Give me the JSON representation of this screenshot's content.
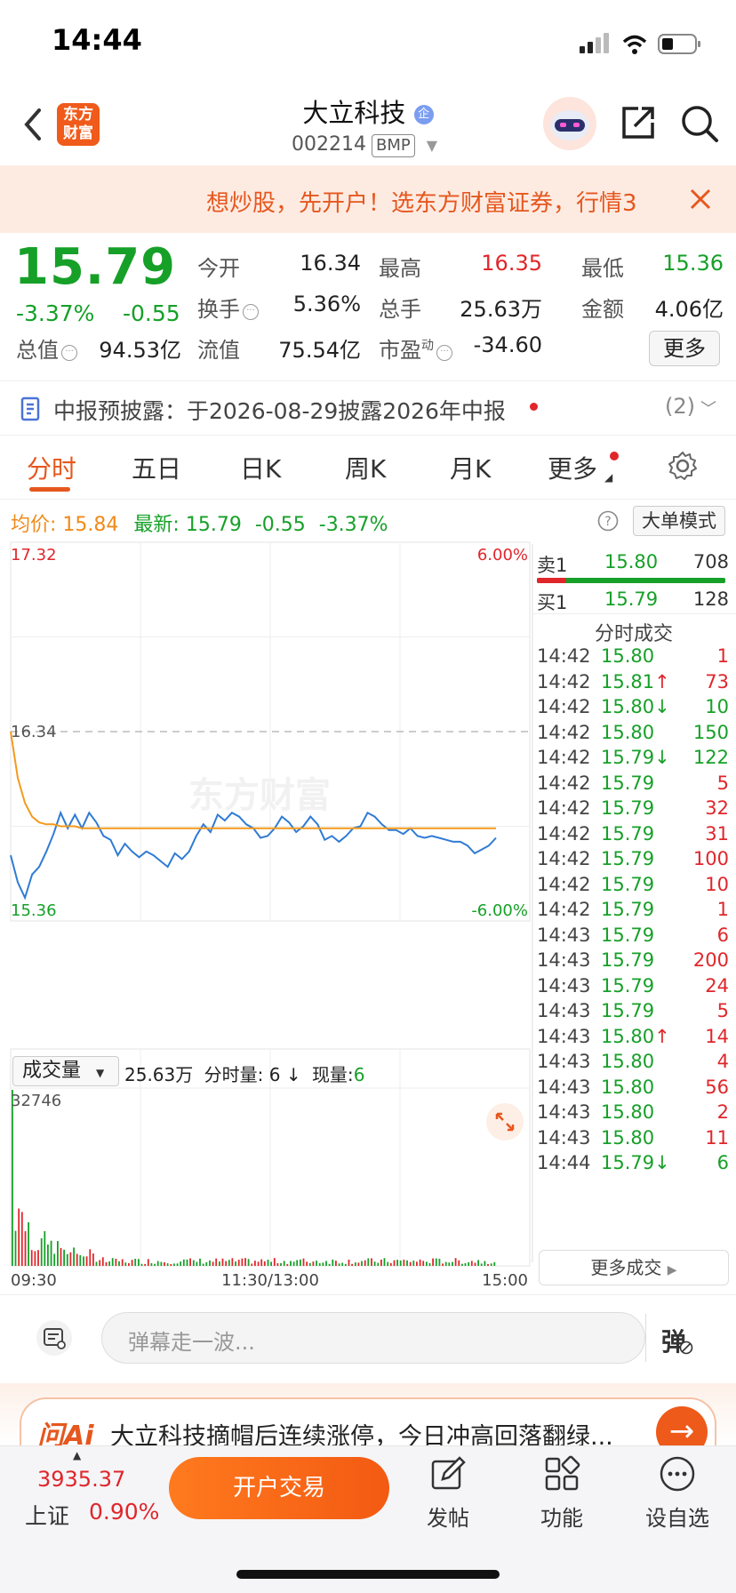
{
  "status_bar": {
    "time": "14:44"
  },
  "header": {
    "app_logo": "东方财富",
    "stock_name": "大立科技",
    "badge": "企",
    "stock_code": "002214",
    "market_tag": "BMP"
  },
  "banner": {
    "text": "想炒股，先开户！选东方财富证券，行情3"
  },
  "quote": {
    "price": "15.79",
    "change_pct": "-3.37%",
    "change": "-0.55",
    "fields": [
      {
        "label": "今开",
        "value": "16.34",
        "color": "#222222"
      },
      {
        "label": "最高",
        "value": "16.35",
        "color": "#e0262b"
      },
      {
        "label": "最低",
        "value": "15.36",
        "color": "#16a028"
      },
      {
        "label": "换手",
        "value": "5.36%",
        "color": "#222222"
      },
      {
        "label": "总手",
        "value": "25.63万",
        "color": "#222222"
      },
      {
        "label": "金额",
        "value": "4.06亿",
        "color": "#222222"
      },
      {
        "label": "总值",
        "value": "94.53亿",
        "color": "#222222"
      },
      {
        "label": "流值",
        "value": "75.54亿",
        "color": "#222222"
      },
      {
        "label": "市盈",
        "value": "-34.60",
        "color": "#222222"
      }
    ],
    "pe_sup": "动",
    "more_label": "更多"
  },
  "notice": {
    "text": "中报预披露：于2026-08-29披露2026年中报",
    "count": "(2)"
  },
  "tabs": [
    "分时",
    "五日",
    "日K",
    "周K",
    "月K",
    "更多"
  ],
  "info_line": {
    "avg_label": "均价:",
    "avg_value": "15.84",
    "latest_label": "最新:",
    "latest_value": "15.79",
    "latest_change": "-0.55",
    "latest_pct": "-3.37%",
    "big_order_label": "大单模式"
  },
  "chart_data": {
    "type": "line",
    "title": "",
    "watermark": "东方财富",
    "y_top_label": "17.32",
    "y_bottom_label": "15.36",
    "pct_top_label": "6.00%",
    "pct_bottom_label": "-6.00%",
    "prev_close_label": "16.34",
    "ylim": [
      15.36,
      17.32
    ],
    "prev_close": 16.34,
    "x_labels": [
      "09:30",
      "11:30/13:00",
      "15:00"
    ],
    "series": [
      {
        "name": "最新",
        "color": "#2f7bd4",
        "values": [
          15.7,
          15.56,
          15.48,
          15.6,
          15.64,
          15.72,
          15.81,
          15.92,
          15.84,
          15.91,
          15.84,
          15.92,
          15.87,
          15.8,
          15.78,
          15.7,
          15.76,
          15.72,
          15.69,
          15.72,
          15.7,
          15.67,
          15.64,
          15.71,
          15.68,
          15.72,
          15.8,
          15.86,
          15.82,
          15.91,
          15.88,
          15.92,
          15.9,
          15.86,
          15.84,
          15.79,
          15.8,
          15.84,
          15.9,
          15.87,
          15.82,
          15.85,
          15.9,
          15.86,
          15.78,
          15.8,
          15.77,
          15.8,
          15.84,
          15.85,
          15.92,
          15.9,
          15.86,
          15.83,
          15.83,
          15.81,
          15.84,
          15.8,
          15.79,
          15.8,
          15.79,
          15.78,
          15.77,
          15.77,
          15.75,
          15.71,
          15.73,
          15.75,
          15.79
        ]
      },
      {
        "name": "均价",
        "color": "#f39a1e",
        "values": [
          16.34,
          16.1,
          15.97,
          15.9,
          15.87,
          15.86,
          15.86,
          15.85,
          15.85,
          15.85,
          15.84,
          15.84,
          15.84,
          15.84,
          15.84,
          15.84,
          15.84,
          15.84,
          15.84,
          15.84,
          15.84,
          15.84,
          15.84,
          15.84,
          15.84,
          15.84,
          15.84,
          15.84,
          15.84,
          15.84,
          15.84,
          15.84,
          15.84,
          15.84,
          15.84,
          15.84,
          15.84,
          15.84,
          15.84,
          15.84,
          15.84,
          15.84,
          15.84,
          15.84,
          15.84,
          15.84,
          15.84,
          15.84,
          15.84,
          15.84,
          15.84,
          15.84,
          15.84,
          15.84,
          15.84,
          15.84,
          15.84,
          15.84,
          15.84,
          15.84,
          15.84,
          15.84,
          15.84,
          15.84,
          15.84,
          15.84,
          15.84,
          15.84,
          15.84
        ]
      }
    ],
    "volume": {
      "selector_label": "成交量",
      "total": "25.63万",
      "period_label": "分时量:",
      "period_value": "6 ↓",
      "current_label": "现量:",
      "current_value": "6",
      "max_label": "32746",
      "max": 32746
    }
  },
  "order_book": {
    "sell": {
      "label": "卖1",
      "price": "15.80",
      "vol": "708"
    },
    "buy": {
      "label": "买1",
      "price": "15.79",
      "vol": "128"
    }
  },
  "trades": {
    "title": "分时成交",
    "rows": [
      {
        "time": "14:42",
        "price": "15.80",
        "arrow": "",
        "vol": "1",
        "dir": "buy"
      },
      {
        "time": "14:42",
        "price": "15.81",
        "arrow": "↑",
        "vol": "73",
        "dir": "buy"
      },
      {
        "time": "14:42",
        "price": "15.80",
        "arrow": "↓",
        "vol": "10",
        "dir": "sell"
      },
      {
        "time": "14:42",
        "price": "15.80",
        "arrow": "",
        "vol": "150",
        "dir": "sell"
      },
      {
        "time": "14:42",
        "price": "15.79",
        "arrow": "↓",
        "vol": "122",
        "dir": "sell"
      },
      {
        "time": "14:42",
        "price": "15.79",
        "arrow": "",
        "vol": "5",
        "dir": "buy"
      },
      {
        "time": "14:42",
        "price": "15.79",
        "arrow": "",
        "vol": "32",
        "dir": "buy"
      },
      {
        "time": "14:42",
        "price": "15.79",
        "arrow": "",
        "vol": "31",
        "dir": "buy"
      },
      {
        "time": "14:42",
        "price": "15.79",
        "arrow": "",
        "vol": "100",
        "dir": "buy"
      },
      {
        "time": "14:42",
        "price": "15.79",
        "arrow": "",
        "vol": "10",
        "dir": "buy"
      },
      {
        "time": "14:42",
        "price": "15.79",
        "arrow": "",
        "vol": "1",
        "dir": "buy"
      },
      {
        "time": "14:43",
        "price": "15.79",
        "arrow": "",
        "vol": "6",
        "dir": "buy"
      },
      {
        "time": "14:43",
        "price": "15.79",
        "arrow": "",
        "vol": "200",
        "dir": "buy"
      },
      {
        "time": "14:43",
        "price": "15.79",
        "arrow": "",
        "vol": "24",
        "dir": "buy"
      },
      {
        "time": "14:43",
        "price": "15.79",
        "arrow": "",
        "vol": "5",
        "dir": "buy"
      },
      {
        "time": "14:43",
        "price": "15.80",
        "arrow": "↑",
        "vol": "14",
        "dir": "buy"
      },
      {
        "time": "14:43",
        "price": "15.80",
        "arrow": "",
        "vol": "4",
        "dir": "buy"
      },
      {
        "time": "14:43",
        "price": "15.80",
        "arrow": "",
        "vol": "56",
        "dir": "buy"
      },
      {
        "time": "14:43",
        "price": "15.80",
        "arrow": "",
        "vol": "2",
        "dir": "buy"
      },
      {
        "time": "14:43",
        "price": "15.80",
        "arrow": "",
        "vol": "11",
        "dir": "buy"
      },
      {
        "time": "14:44",
        "price": "15.79",
        "arrow": "↓",
        "vol": "6",
        "dir": "sell"
      }
    ],
    "more_label": "更多成交"
  },
  "comment_bar": {
    "placeholder": "弹幕走一波...",
    "danmu_label": "弹"
  },
  "ai_bar": {
    "logo": "问Ai",
    "text": "大立科技摘帽后连续涨停，今日冲高回落翻绿..."
  },
  "bottom_nav": {
    "index_value": "3935.37",
    "index_name": "上证",
    "index_pct": "0.90%",
    "trade_button": "开户交易",
    "items": [
      "发帖",
      "功能",
      "设自选"
    ]
  },
  "colors": {
    "up": "#e0262b",
    "down": "#16a028",
    "accent": "#e6571e",
    "price_line": "#2f7bd4",
    "avg_line": "#f39a1e"
  }
}
